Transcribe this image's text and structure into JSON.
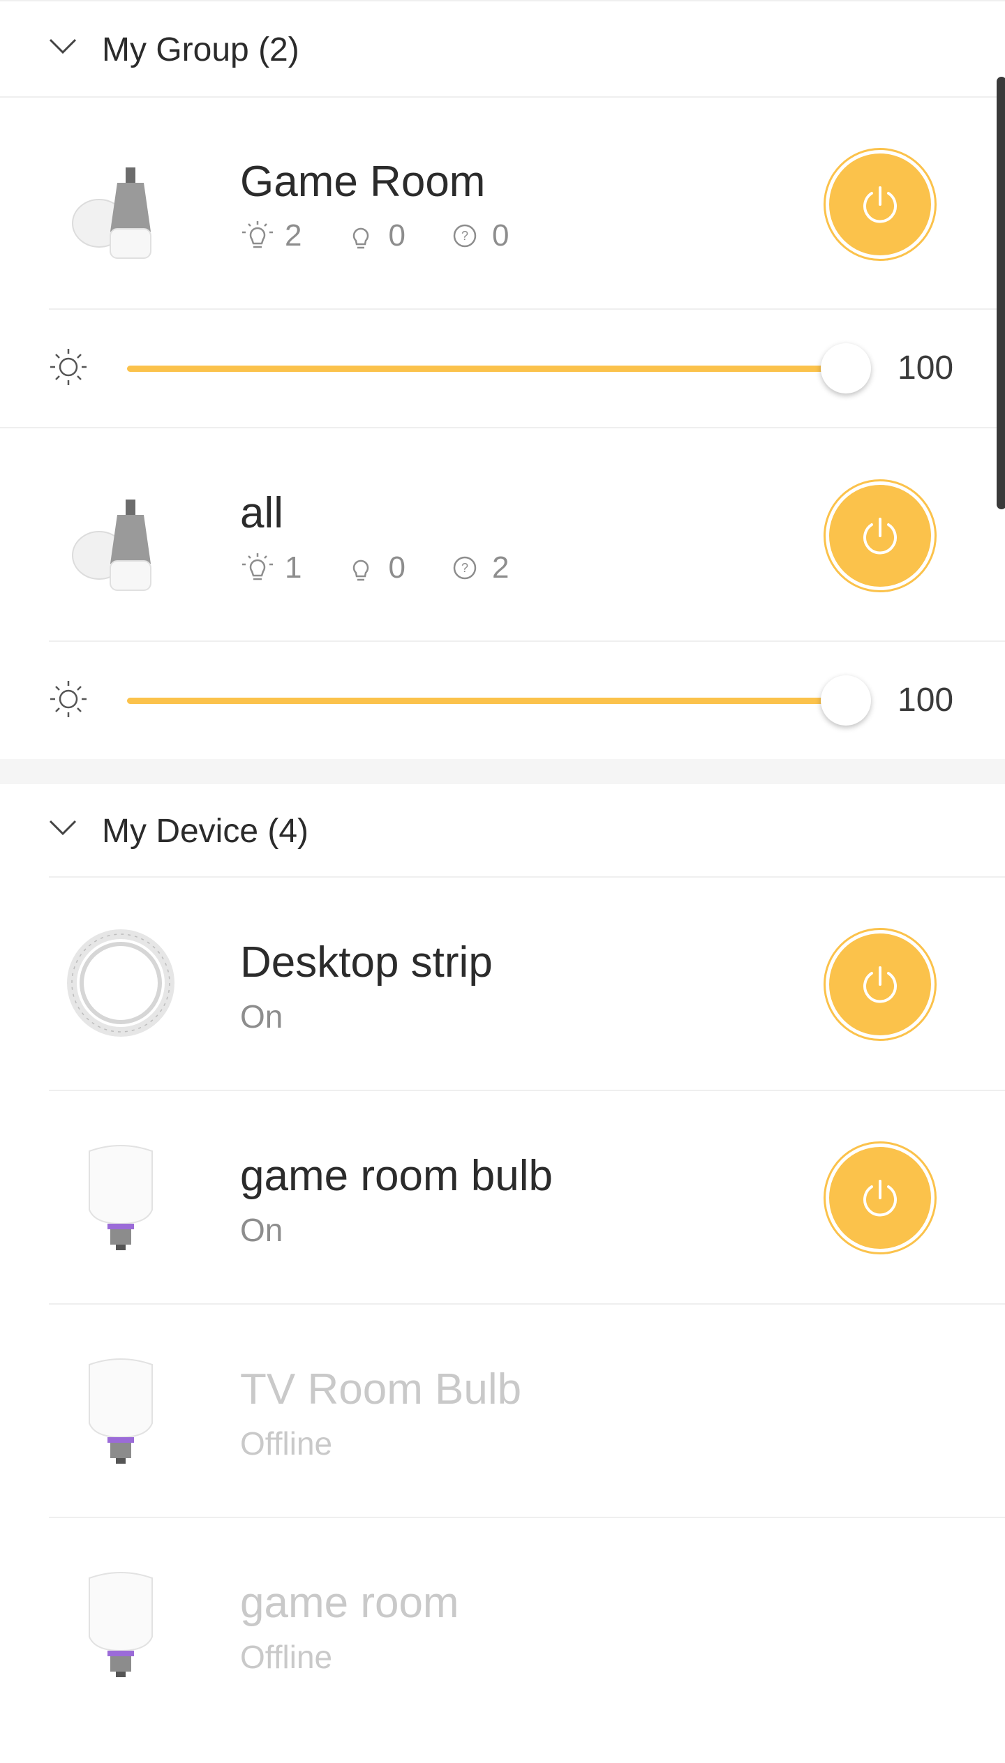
{
  "groups_section": {
    "title": "My Group (2)",
    "groups": [
      {
        "name": "Game Room",
        "on_count": "2",
        "off_count": "0",
        "unknown_count": "0",
        "brightness": "100",
        "brightness_fraction": 1.0
      },
      {
        "name": "all",
        "on_count": "1",
        "off_count": "0",
        "unknown_count": "2",
        "brightness": "100",
        "brightness_fraction": 1.0
      }
    ]
  },
  "devices_section": {
    "title": "My Device (4)",
    "devices": [
      {
        "name": "Desktop strip",
        "status": "On"
      },
      {
        "name": "game room bulb",
        "status": "On"
      },
      {
        "name": "TV Room Bulb",
        "status": "Offline"
      },
      {
        "name": "game room",
        "status": "Offline"
      }
    ]
  },
  "colors": {
    "accent": "#fbc24b",
    "text": "#2b2b2b",
    "muted": "#8d8d8d",
    "offline": "#c9c9c9"
  },
  "icons": [
    "chevron-down-icon",
    "bulb-on-icon",
    "bulb-off-icon",
    "question-icon",
    "brightness-icon",
    "power-icon"
  ]
}
